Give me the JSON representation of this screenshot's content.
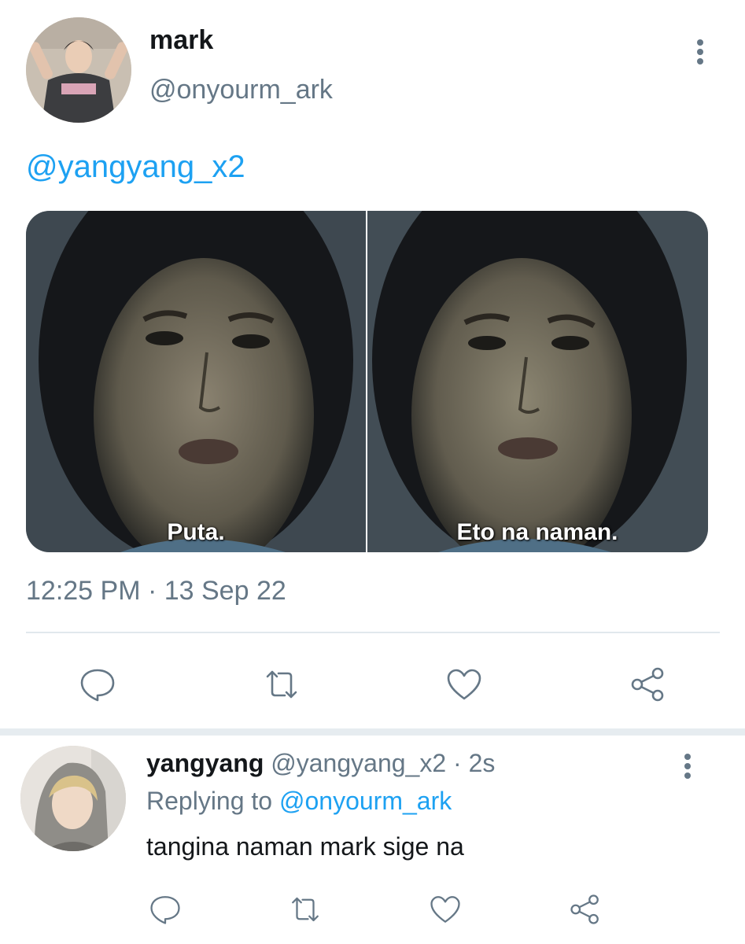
{
  "main_tweet": {
    "author_name": "mark",
    "author_handle": "@onyourm_ark",
    "mention": "@yangyang_x2",
    "image_captions": [
      "Puta.",
      "Eto na naman."
    ],
    "timestamp": "12:25 PM · 13 Sep 22"
  },
  "reply": {
    "author_name": "yangyang",
    "author_handle": "@yangyang_x2",
    "separator": " · ",
    "time_ago": "2s",
    "replying_prefix": "Replying to ",
    "replying_to_handle": "@onyourm_ark",
    "text": "tangina naman mark sige na"
  },
  "icons": {
    "reply": "reply-bubble-icon",
    "retweet": "retweet-icon",
    "like": "heart-icon",
    "share": "share-icon",
    "more": "vertical-dots-icon"
  },
  "colors": {
    "accent": "#1da1f2",
    "secondary_text": "#657786",
    "primary_text": "#14171a",
    "divider": "#e1e8ed"
  }
}
